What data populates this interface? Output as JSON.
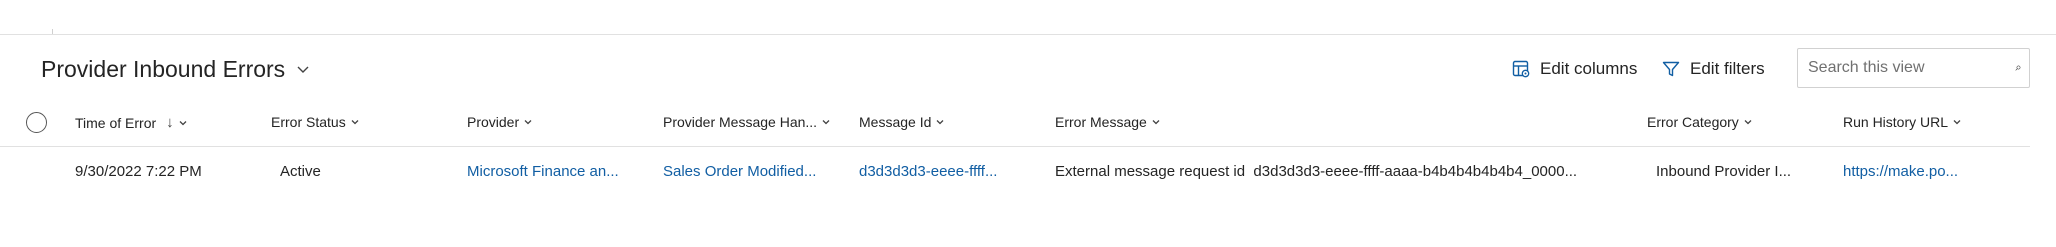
{
  "view": {
    "title": "Provider Inbound Errors"
  },
  "commands": {
    "edit_columns": "Edit columns",
    "edit_filters": "Edit filters"
  },
  "search": {
    "placeholder": "Search this view"
  },
  "columns": [
    {
      "label": "Time of Error",
      "sort": "descending"
    },
    {
      "label": "Error Status"
    },
    {
      "label": "Provider"
    },
    {
      "label": "Provider Message Han..."
    },
    {
      "label": "Message Id"
    },
    {
      "label": "Error Message"
    },
    {
      "label": "Error Category"
    },
    {
      "label": "Run History URL"
    }
  ],
  "rows": [
    {
      "time_of_error": "9/30/2022 7:22 PM",
      "error_status": "Active",
      "provider": "Microsoft Finance an...",
      "provider_message_handler": "Sales Order Modified...",
      "message_id": "d3d3d3d3-eeee-ffff...",
      "error_message": "External message request id  d3d3d3d3-eeee-ffff-aaaa-b4b4b4b4b4b4_0000...",
      "error_category": "Inbound Provider I...",
      "run_history_url": "https://make.po..."
    }
  ],
  "colors": {
    "link": "#115ea3",
    "text": "#242424",
    "divider": "#e1e1e1"
  },
  "icons": {
    "title_chevron": "chevron-down-icon",
    "edit_columns": "edit-columns-icon",
    "edit_filters": "filter-icon",
    "search": "search-icon",
    "sort": "arrow-down-icon"
  }
}
